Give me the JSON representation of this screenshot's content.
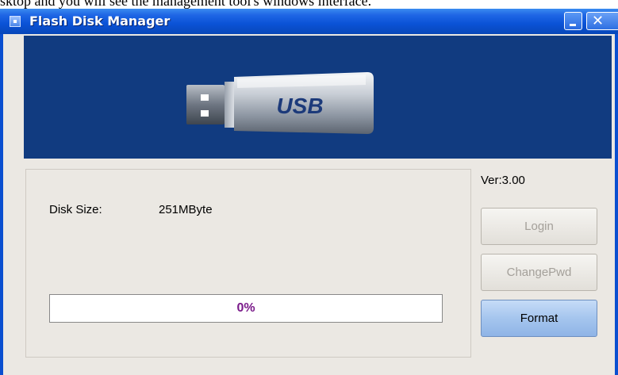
{
  "page_caption": "sktop and you will see the management tool's windows interface.",
  "window": {
    "title": "Flash Disk Manager",
    "minimize_glyph": "_",
    "close_glyph": "✕"
  },
  "banner": {
    "usb_label": "USB",
    "background_color": "#113b80"
  },
  "disk_info": {
    "size_label": "Disk Size:",
    "size_value": "251MByte"
  },
  "progress": {
    "percent": 0,
    "text": "0%",
    "text_color": "#7a1a8a"
  },
  "version": "Ver:3.00",
  "buttons": {
    "login": "Login",
    "change_pwd": "ChangePwd",
    "format": "Format"
  }
}
